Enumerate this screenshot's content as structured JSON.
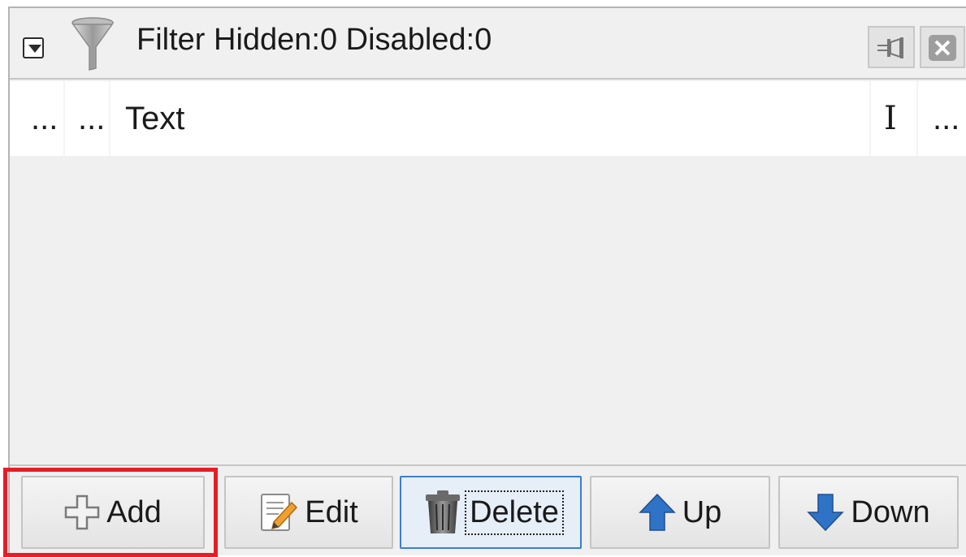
{
  "header": {
    "title": "Filter Hidden:0 Disabled:0",
    "icons": [
      "collapse-icon",
      "funnel-icon",
      "pin-icon",
      "close-icon"
    ]
  },
  "table": {
    "rows": [
      {
        "col1": "...",
        "col2": "...",
        "text": "Text",
        "col4": "I",
        "col5": "..."
      }
    ]
  },
  "toolbar": {
    "add_label": "Add",
    "edit_label": "Edit",
    "delete_label": "Delete",
    "up_label": "Up",
    "down_label": "Down"
  },
  "colors": {
    "highlight": "#e41e26",
    "focus_border": "#3c7fd0",
    "arrow_blue": "#2f73c6"
  }
}
